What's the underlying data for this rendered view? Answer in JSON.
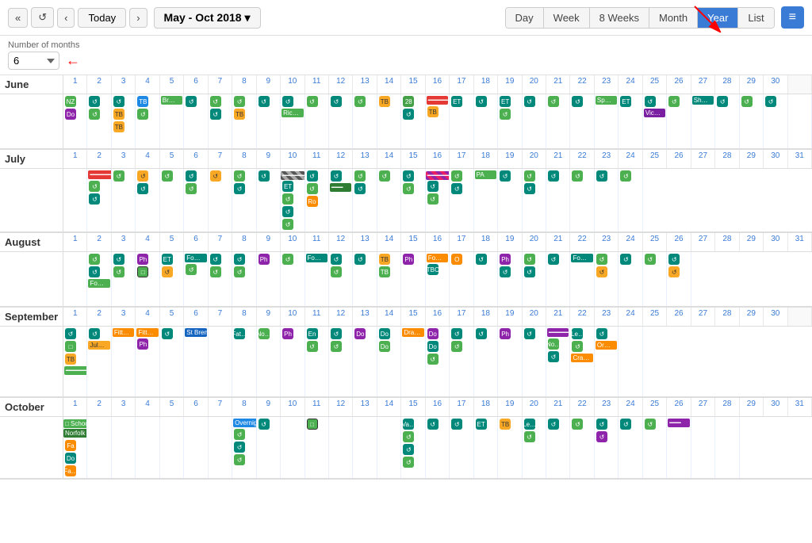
{
  "toolbar": {
    "back_back_label": "«",
    "refresh_label": "↺",
    "back_label": "‹",
    "today_label": "Today",
    "forward_label": "›",
    "date_range": "May - Oct 2018 ▾",
    "views": [
      {
        "id": "day",
        "label": "Day"
      },
      {
        "id": "week",
        "label": "Week"
      },
      {
        "id": "8weeks",
        "label": "8 Weeks"
      },
      {
        "id": "month",
        "label": "Month"
      },
      {
        "id": "year",
        "label": "Year",
        "active": true
      },
      {
        "id": "list",
        "label": "List"
      }
    ],
    "menu_label": "≡"
  },
  "sub_toolbar": {
    "num_months_label": "Number of months",
    "num_months_value": "6"
  },
  "months": [
    "June",
    "July",
    "August",
    "September",
    "October"
  ],
  "june_days": 30,
  "july_days": 31,
  "august_days": 31,
  "september_days": 30,
  "october_days": 31
}
